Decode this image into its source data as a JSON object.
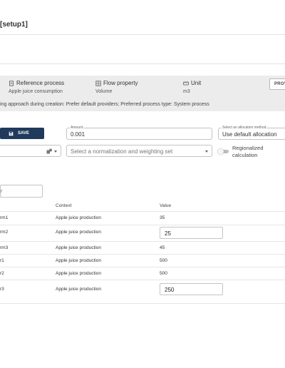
{
  "page": {
    "title": "[setup1]"
  },
  "info": {
    "reference_process": {
      "label": "Reference process",
      "value": "Apple juice consumption",
      "icon": "reference-process-icon"
    },
    "flow_property": {
      "label": "Flow property",
      "value": "Volume",
      "icon": "flow-property-icon"
    },
    "unit": {
      "label": "Unit",
      "value": "m3",
      "icon": "unit-icon"
    },
    "provider_button": "PROV",
    "approach": "ing approach during creation: Prefer default providers; Preferred process type: System process"
  },
  "toolbar": {
    "save_label": "SAVE",
    "amount": {
      "label": "Amount",
      "value": "0.001"
    },
    "allocation": {
      "label": "Select an allocation method",
      "value": "Use default allocation"
    },
    "normalization": {
      "placeholder": "Select a normalization and weighting set"
    },
    "regionalized": {
      "label": "Regionalized calculation"
    }
  },
  "filter": {
    "value": "r"
  },
  "table": {
    "headers": {
      "name": "",
      "context": "Context",
      "value": "Value"
    },
    "rows": [
      {
        "name": "rm1",
        "context": "Apple juice production",
        "value": "35",
        "editable": false
      },
      {
        "name": "rm2",
        "context": "Apple juice production",
        "value": "25",
        "editable": true
      },
      {
        "name": "rm3",
        "context": "Apple juice production",
        "value": "45",
        "editable": false
      },
      {
        "name": "r1",
        "context": "Apple juice production",
        "value": "500",
        "editable": false
      },
      {
        "name": "r2",
        "context": "Apple juice production",
        "value": "500",
        "editable": false
      },
      {
        "name": "r3",
        "context": "Apple juice production",
        "value": "250",
        "editable": true
      }
    ]
  },
  "colors": {
    "save_bg": "#1f3a5c",
    "panel_bg": "#ececec"
  }
}
